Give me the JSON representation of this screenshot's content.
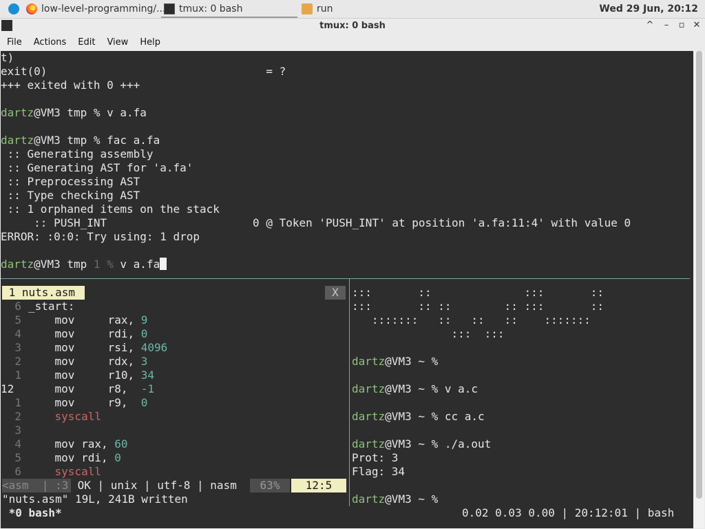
{
  "panel": {
    "tasks": [
      {
        "label": "low-level-programming/..."
      },
      {
        "label": "tmux: 0 bash"
      },
      {
        "label": "run"
      }
    ],
    "clock": "Wed 29 Jun, 20:12"
  },
  "window": {
    "title": "tmux: 0 bash",
    "controls": {
      "minimize": "^",
      "restore": "–",
      "maximize": "▫",
      "close": "✕"
    }
  },
  "menu": [
    "File",
    "Actions",
    "Edit",
    "View",
    "Help"
  ],
  "top_pane": {
    "l0": "t)",
    "l1": "exit(0)                                 = ?",
    "l2": "+++ exited with 0 +++",
    "user": "dartz",
    "host_dir": "@VM3 tmp ",
    "prompt_sep": "% ",
    "cmd1": "v a.fa",
    "cmd2": "fac a.fa",
    "out1": " :: Generating assembly",
    "out2": " :: Generating AST for 'a.fa'",
    "out3": " :: Preprocessing AST",
    "out4": " :: Type checking AST",
    "out5": " :: 1 orphaned items on the stack",
    "out6": "     :: PUSH_INT                      0 @ Token 'PUSH_INT' at position 'a.fa:11:4' with value 0",
    "out7": "ERROR: :0:0: Try using: 1 drop",
    "exit_code": "1 ",
    "cmd3": "v a.fa"
  },
  "vim": {
    "tab_label": " 1 nuts.asm",
    "close": "X",
    "lines": [
      {
        "n": "6",
        "t": "_start:"
      },
      {
        "n": "5",
        "t": "    mov     rax, ",
        "v": "9"
      },
      {
        "n": "4",
        "t": "    mov     rdi, ",
        "v": "0"
      },
      {
        "n": "3",
        "t": "    mov     rsi, ",
        "v": "4096"
      },
      {
        "n": "2",
        "t": "    mov     rdx, ",
        "v": "3"
      },
      {
        "n": "1",
        "t": "    mov     r10, ",
        "v": "34"
      },
      {
        "n": "12",
        "t": "    mov     r8,  ",
        "v": "-1"
      },
      {
        "n": "1",
        "t": "    mov     r9,  ",
        "v": "0"
      },
      {
        "n": "2",
        "t": "    ",
        "k": "syscall"
      },
      {
        "n": "3",
        "t": ""
      },
      {
        "n": "4",
        "t": "    mov rax, ",
        "v": "60"
      },
      {
        "n": "5",
        "t": "    mov rdi, ",
        "v": "0"
      },
      {
        "n": "6",
        "t": "    ",
        "k": "syscall"
      }
    ],
    "status_mode": "<asm  | :3",
    "status_info": " OK | unix | utf-8 | nasm",
    "status_pct": "63%",
    "status_pos": "12:5",
    "message": "\"nuts.asm\" 19L, 241B written"
  },
  "right_pane": {
    "art1": ":::       ::              :::       ::",
    "art2": ":::       :: ::        :: :::       ::",
    "art3": "   :::::::   ::   ::   ::    :::::::",
    "art4": "               :::  :::",
    "user": "dartz",
    "host": "@VM3 ~ % ",
    "cmd1": "v a.c",
    "cmd2": "cc a.c",
    "cmd3": "./a.out",
    "out1": "Prot: 3",
    "out2": "Flag: 34"
  },
  "tmux_status": {
    "left": " *0 bash*",
    "right": "0.02 0.03 0.00 | 20:12:01 | bash"
  }
}
